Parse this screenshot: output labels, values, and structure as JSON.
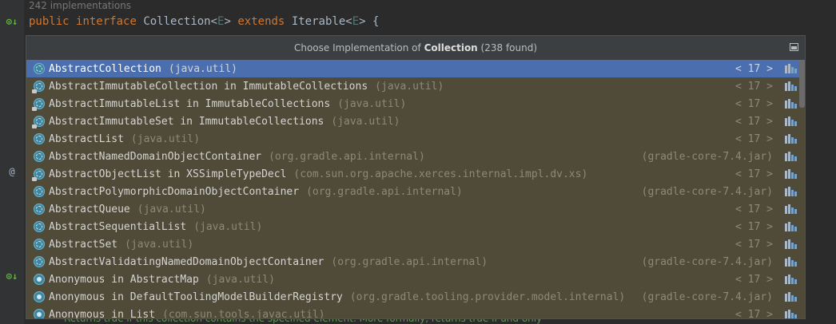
{
  "editor": {
    "implementations_hint": "242 implementations",
    "code": {
      "kw_public": "public",
      "kw_interface": "interface",
      "name": "Collection",
      "lt1": "<",
      "tp1": "E",
      "gt1": ">",
      "kw_extends": "extends",
      "parent": "Iterable",
      "lt2": "<",
      "tp2": "E",
      "gt2": ">",
      "brace": "{"
    },
    "bottom_doc": "Returns true if this collection contains the specified element. More formally, returns true if and only"
  },
  "gutter": {
    "mark_impl_1": "⊙↓",
    "mark_at": "@",
    "mark_impl_2": "⊙↓"
  },
  "popup": {
    "title_prefix": "Choose Implementation of ",
    "title_bold": "Collection",
    "title_suffix": " (238 found)",
    "items": [
      {
        "name": "AbstractCollection",
        "pkg": "(java.util)",
        "loc": "< 17 >",
        "icon": "abstract-class-icon",
        "selected": true
      },
      {
        "name": "AbstractImmutableCollection in ImmutableCollections",
        "pkg": "(java.util)",
        "loc": "< 17 >",
        "icon": "abstract-class-locked-icon"
      },
      {
        "name": "AbstractImmutableList in ImmutableCollections",
        "pkg": "(java.util)",
        "loc": "< 17 >",
        "icon": "abstract-class-locked-icon"
      },
      {
        "name": "AbstractImmutableSet in ImmutableCollections",
        "pkg": "(java.util)",
        "loc": "< 17 >",
        "icon": "abstract-class-locked-icon"
      },
      {
        "name": "AbstractList",
        "pkg": "(java.util)",
        "loc": "< 17 >",
        "icon": "abstract-class-icon"
      },
      {
        "name": "AbstractNamedDomainObjectContainer",
        "pkg": "(org.gradle.api.internal)",
        "loc": "(gradle-core-7.4.jar)",
        "icon": "abstract-class-icon"
      },
      {
        "name": "AbstractObjectList in XSSimpleTypeDecl",
        "pkg": "(com.sun.org.apache.xerces.internal.impl.dv.xs)",
        "loc": "< 17 >",
        "icon": "abstract-class-locked-icon"
      },
      {
        "name": "AbstractPolymorphicDomainObjectContainer",
        "pkg": "(org.gradle.api.internal)",
        "loc": "(gradle-core-7.4.jar)",
        "icon": "abstract-class-icon"
      },
      {
        "name": "AbstractQueue",
        "pkg": "(java.util)",
        "loc": "< 17 >",
        "icon": "abstract-class-icon"
      },
      {
        "name": "AbstractSequentialList",
        "pkg": "(java.util)",
        "loc": "< 17 >",
        "icon": "abstract-class-icon"
      },
      {
        "name": "AbstractSet",
        "pkg": "(java.util)",
        "loc": "< 17 >",
        "icon": "abstract-class-icon"
      },
      {
        "name": "AbstractValidatingNamedDomainObjectContainer",
        "pkg": "(org.gradle.api.internal)",
        "loc": "(gradle-core-7.4.jar)",
        "icon": "abstract-class-icon"
      },
      {
        "name": "Anonymous in AbstractMap",
        "pkg": "(java.util)",
        "loc": "< 17 >",
        "icon": "anonymous-class-icon"
      },
      {
        "name": "Anonymous in DefaultToolingModelBuilderRegistry",
        "pkg": "(org.gradle.tooling.provider.model.internal)",
        "loc": "(gradle-core-7.4.jar)",
        "icon": "anonymous-class-icon"
      },
      {
        "name": "Anonymous in List",
        "pkg": "(com.sun.tools.javac.util)",
        "loc": "< 17 >",
        "icon": "anonymous-class-icon"
      }
    ]
  },
  "colors": {
    "popup_bg": "#504b38",
    "selected_bg": "#4b6eaf",
    "editor_bg": "#2b2b2b",
    "keyword": "#cc7832"
  }
}
